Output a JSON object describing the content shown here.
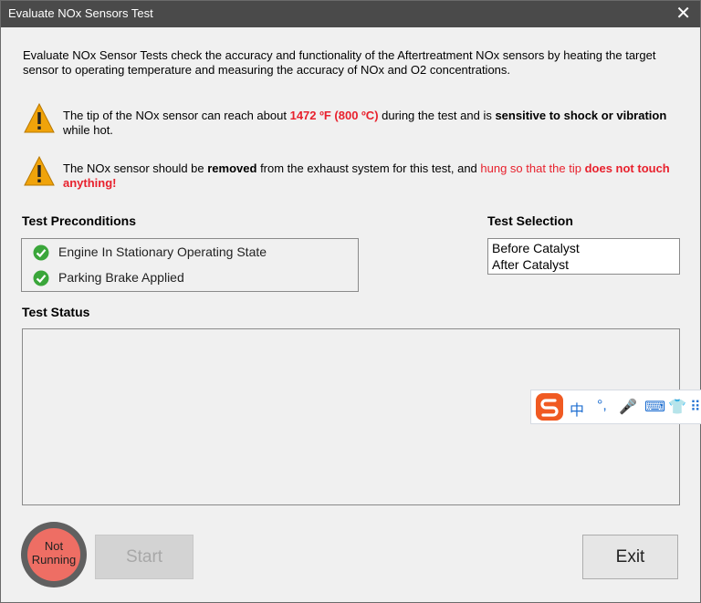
{
  "window": {
    "title": "Evaluate NOx Sensors Test",
    "close_glyph": "✕"
  },
  "description": "Evaluate NOx Sensor Tests check the accuracy and functionality of the Aftertreatment NOx sensors by heating the target sensor to operating temperature and measuring the accuracy of NOx and O2 concentrations.",
  "warning1": {
    "t1": "The tip of the NOx sensor can reach about ",
    "temp": "1472 ºF (800 ºC)",
    "t2": " during the test and is ",
    "sensitive": "sensitive to shock or vibration",
    "t3": " while hot."
  },
  "warning2": {
    "t1": "The NOx sensor should be ",
    "removed": "removed",
    "t2": " from the exhaust system for this test, and ",
    "hung": "hung so that the tip ",
    "notouch": "does not touch anything!"
  },
  "preconditions": {
    "label": "Test Preconditions",
    "items": [
      {
        "text": "Engine In Stationary Operating State"
      },
      {
        "text": "Parking Brake Applied"
      }
    ]
  },
  "selection": {
    "label": "Test Selection",
    "options": [
      "Before Catalyst",
      "After Catalyst"
    ]
  },
  "status": {
    "label": "Test Status"
  },
  "ime": {
    "chars": [
      "中",
      "°,",
      "🎤",
      "⌨",
      "👕",
      "⠿"
    ]
  },
  "indicator": {
    "line1": "Not",
    "line2": "Running"
  },
  "buttons": {
    "start": "Start",
    "exit": "Exit"
  },
  "colors": {
    "warning_red": "#e8212d",
    "check_green": "#3aa63a",
    "indicator_red": "#ee6e64",
    "titlebar": "#4a4a4a",
    "ime_orange": "#f05a22",
    "ime_blue": "#1f6fd1"
  }
}
